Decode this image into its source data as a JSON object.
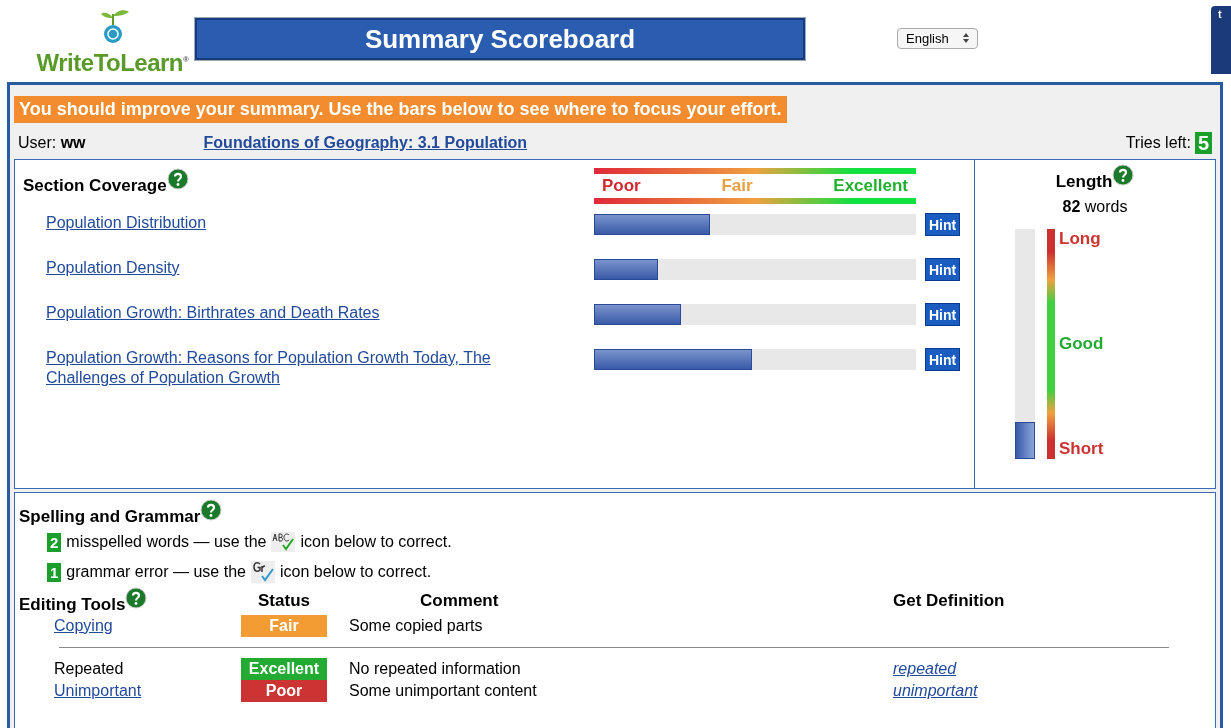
{
  "logo": {
    "text": "WriteToLearn",
    "mark": "®"
  },
  "title": "Summary Scoreboard",
  "language": "English",
  "corner_tab": "t",
  "banner": "You should improve your summary. Use the bars below to see where to focus your effort.",
  "user": {
    "label": "User:",
    "name": "ww"
  },
  "assignment": "Foundations of Geography: 3.1 Population",
  "tries": {
    "label": "Tries left:",
    "count": "5"
  },
  "coverage": {
    "title": "Section Coverage",
    "legend": [
      "Poor",
      "Fair",
      "Excellent"
    ],
    "sections": [
      {
        "name": "Population Distribution",
        "level": 0.36,
        "hint": "Hint"
      },
      {
        "name": "Population Density",
        "level": 0.2,
        "hint": "Hint"
      },
      {
        "name": "Population Growth: Birthrates and Death Rates",
        "level": 0.27,
        "hint": "Hint"
      },
      {
        "name": "Population Growth: Reasons for Population Growth Today, The Challenges of Population Growth",
        "level": 0.49,
        "hint": "Hint"
      }
    ]
  },
  "length": {
    "title": "Length",
    "count": "82",
    "unit": "words",
    "level": 0.16,
    "scale": [
      "Long",
      "Good",
      "Short"
    ]
  },
  "spelling": {
    "title": "Spelling and Grammar",
    "items": [
      {
        "kind": "spelling",
        "count": "2",
        "before": "misspelled words — use the",
        "after": "icon below to correct."
      },
      {
        "kind": "grammar",
        "count": "1",
        "before": "grammar error — use the",
        "after": "icon below to correct."
      }
    ]
  },
  "editing": {
    "title": "Editing Tools",
    "columns": [
      "Status",
      "Comment",
      "Get Definition"
    ],
    "rows": [
      {
        "name": "Copying",
        "link": true,
        "status": "Fair",
        "color": "#f39c34",
        "comment": "Some copied parts",
        "divider": true
      },
      {
        "name": "Repeated",
        "link": false,
        "status": "Excellent",
        "color": "#22aa33",
        "comment": "No repeated information",
        "definition": "repeated",
        "divider": false
      },
      {
        "name": "Unimportant",
        "link": true,
        "status": "Poor",
        "color": "#cc3333",
        "comment": "Some unimportant content",
        "definition": "unimportant",
        "divider": false
      }
    ]
  }
}
